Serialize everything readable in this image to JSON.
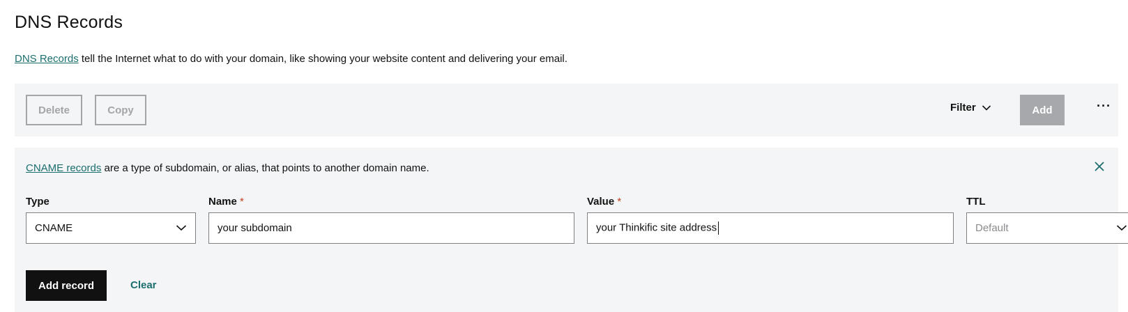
{
  "page": {
    "title": "DNS Records"
  },
  "intro": {
    "link_text": "DNS Records",
    "text": " tell the Internet what to do with your domain, like showing your website content and delivering your email."
  },
  "toolbar": {
    "delete_label": "Delete",
    "copy_label": "Copy",
    "filter_label": "Filter",
    "add_label": "Add",
    "more_label": "···"
  },
  "panel": {
    "note_link": "CNAME records",
    "note_text": " are a type of subdomain, or alias, that points to another domain name.",
    "fields": {
      "type": {
        "label": "Type",
        "value": "CNAME"
      },
      "name": {
        "label": "Name",
        "required_mark": "*",
        "value": "your subdomain"
      },
      "value": {
        "label": "Value",
        "required_mark": "*",
        "value": "your Thinkific site address"
      },
      "ttl": {
        "label": "TTL",
        "value": "Default"
      }
    },
    "add_record_label": "Add record",
    "clear_label": "Clear"
  },
  "colors": {
    "accent_link": "#1b6e6e",
    "required": "#c2401f",
    "disabled": "#a6a8ab",
    "panel_bg": "#f4f5f6",
    "primary_button": "#111111"
  },
  "icons": {
    "filter": "chevron-down-icon",
    "more": "more-horizontal-icon",
    "close": "close-icon",
    "select": "chevron-down-icon"
  }
}
